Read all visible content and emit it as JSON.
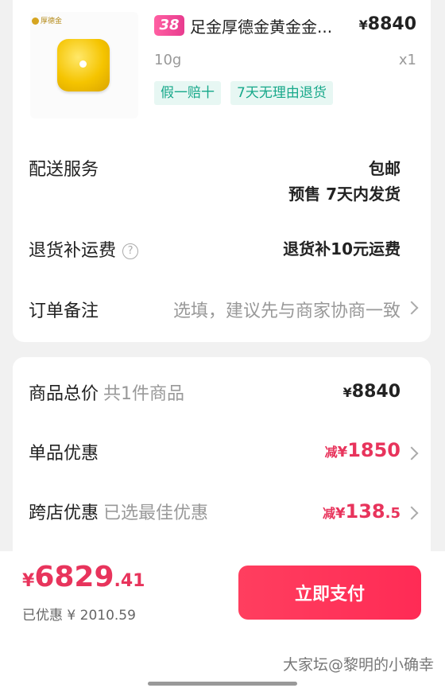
{
  "product": {
    "brand_mark": "厚德金",
    "badge": "38",
    "title": "足金厚德金黄金金...",
    "price_symbol": "¥",
    "price": "8840",
    "spec": "10g",
    "quantity": "x1",
    "tags": [
      "假一赔十",
      "7天无理由退货"
    ]
  },
  "delivery": {
    "label": "配送服务",
    "line1": "包邮",
    "line2": "预售 7天内发货"
  },
  "return_shipping": {
    "label": "退货补运费",
    "help_icon": "?",
    "value": "退货补10元运费"
  },
  "order_note": {
    "label": "订单备注",
    "placeholder": "选填，建议先与商家协商一致"
  },
  "summary": {
    "total": {
      "label": "商品总价",
      "sub": "共1件商品",
      "symbol": "¥",
      "value": "8840"
    },
    "item_discount": {
      "label": "单品优惠",
      "prefix": "减",
      "symbol": "¥",
      "value": "1850"
    },
    "cross_store_discount": {
      "label": "跨店优惠",
      "sub": "已选最佳优惠",
      "prefix": "减",
      "symbol": "¥",
      "value_int": "138",
      "value_dec": ".5"
    }
  },
  "footer": {
    "total_symbol": "¥",
    "total_int": "6829",
    "total_dec": ".41",
    "saved_text": "已优惠 ¥ 2010.59",
    "pay_label": "立即支付"
  },
  "watermark": "大家坛@黎明的小确幸",
  "colors": {
    "accent": "#e8345c",
    "tag_green": "#17a88a",
    "pay_button": "#ff2b55"
  }
}
